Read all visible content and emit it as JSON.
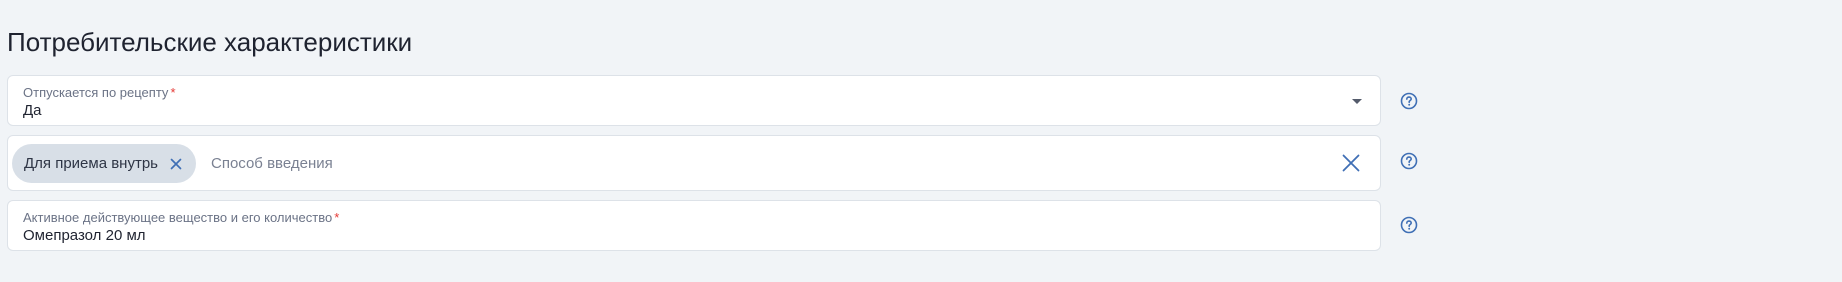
{
  "section": {
    "title": "Потребительские характеристики"
  },
  "prescription": {
    "label": "Отпускается по рецепту",
    "required_mark": "*",
    "value": "Да"
  },
  "administration": {
    "chips": [
      {
        "label": "Для приема внутрь"
      }
    ],
    "placeholder": "Способ введения"
  },
  "active_substance": {
    "label": "Активное действующее вещество и его количество",
    "required_mark": "*",
    "value": "Омепразол 20 мл"
  },
  "icons": {
    "dropdown": "chevron-down-icon",
    "chip_remove": "close-icon",
    "clear": "close-icon",
    "help": "help-circle-icon"
  },
  "colors": {
    "accent": "#3f6fb5",
    "required": "#e53935",
    "background": "#f1f4f7",
    "chip_bg": "#d8dfe7"
  }
}
